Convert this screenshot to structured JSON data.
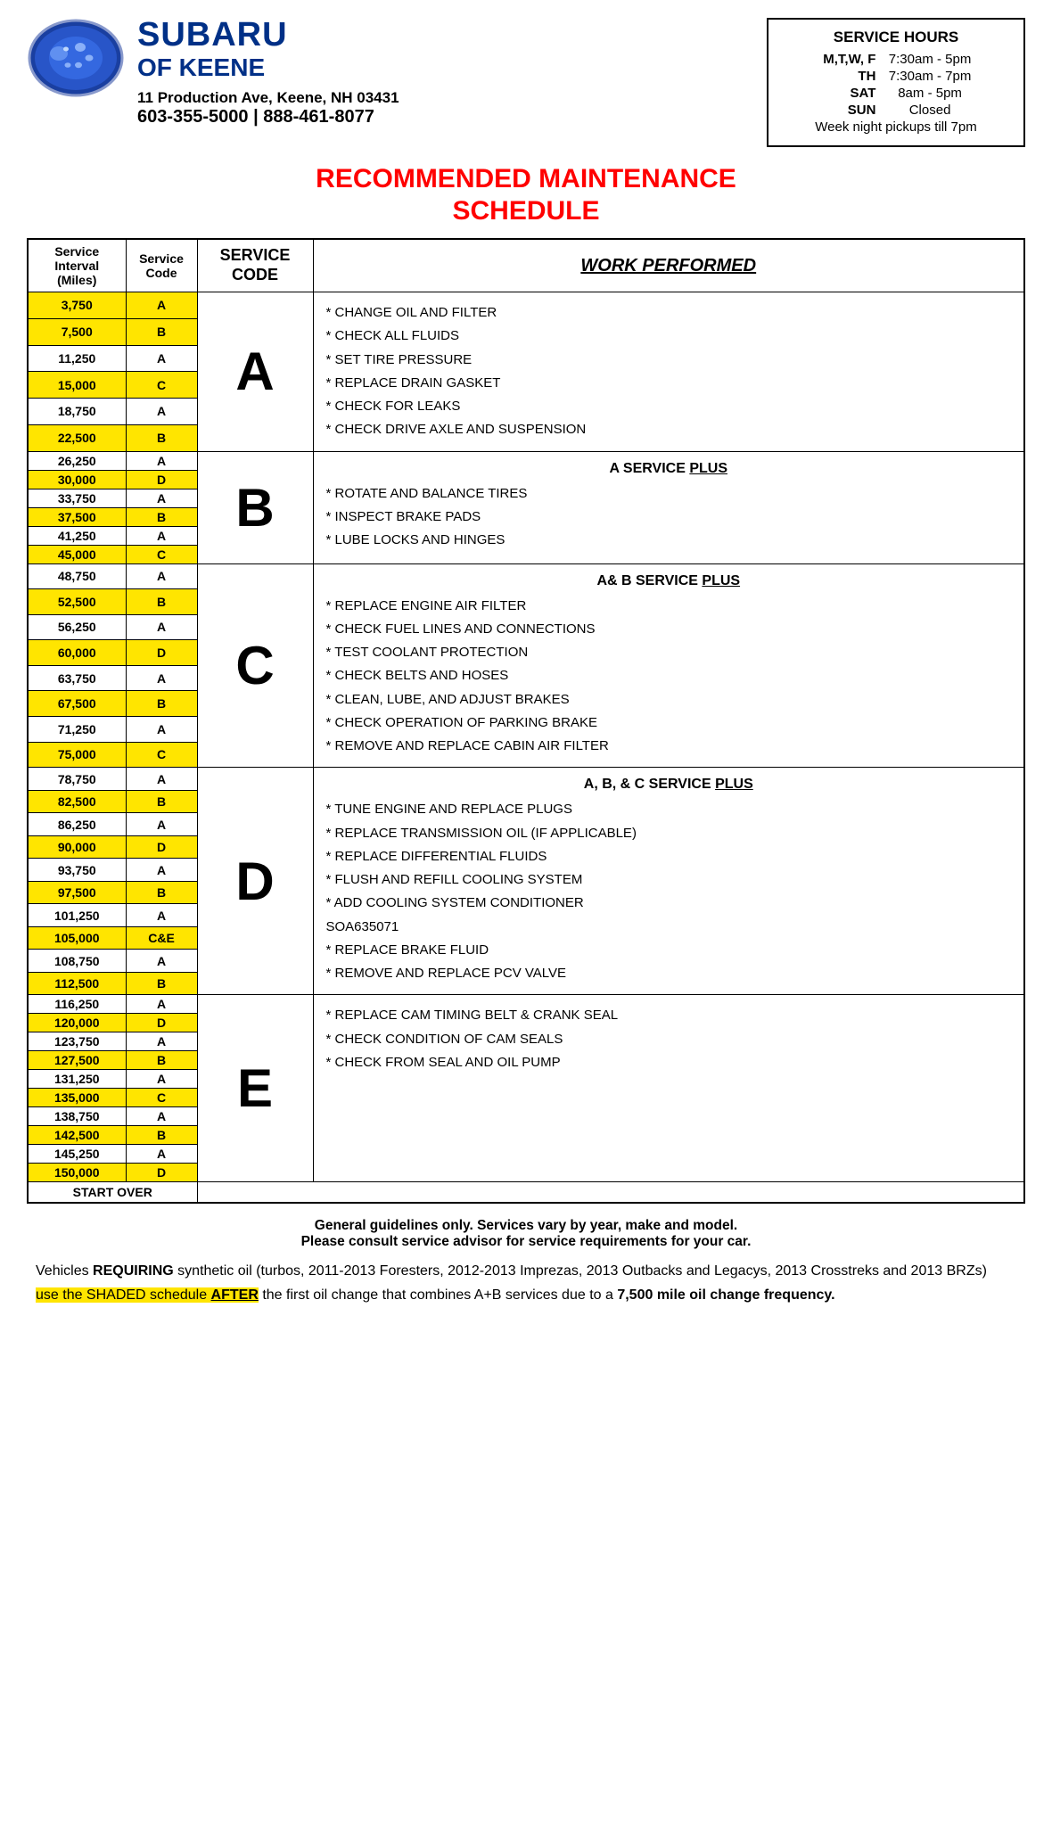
{
  "dealer": {
    "name": "SUBARU",
    "sub": "OF KEENE",
    "address": "11 Production Ave, Keene, NH  03431",
    "phone": "603-355-5000 | 888-461-8077"
  },
  "hours": {
    "title": "SERVICE HOURS",
    "rows": [
      {
        "days": "M,T,W, F",
        "time": "7:30am - 5pm"
      },
      {
        "days": "TH",
        "time": "7:30am - 7pm"
      },
      {
        "days": "SAT",
        "time": "8am - 5pm"
      },
      {
        "days": "SUN",
        "time": "Closed"
      },
      {
        "days": "",
        "time": "Week night pickups till 7pm"
      }
    ]
  },
  "main_title": "RECOMMENDED MAINTENANCE SCHEDULE",
  "table": {
    "header": {
      "interval_line1": "Service Interval",
      "interval_line2": "(Miles)",
      "code_header": "Service Code",
      "service_code_label": "SERVICE CODE",
      "work_performed_label": "WORK PERFORMED"
    },
    "intervals": [
      {
        "miles": "3,750",
        "code": "A",
        "yellow": true
      },
      {
        "miles": "7,500",
        "code": "B",
        "yellow": true
      },
      {
        "miles": "11,250",
        "code": "A",
        "yellow": false
      },
      {
        "miles": "15,000",
        "code": "C",
        "yellow": true
      },
      {
        "miles": "18,750",
        "code": "A",
        "yellow": false
      },
      {
        "miles": "22,500",
        "code": "B",
        "yellow": true
      },
      {
        "miles": "26,250",
        "code": "A",
        "yellow": false
      },
      {
        "miles": "30,000",
        "code": "D",
        "yellow": true
      },
      {
        "miles": "33,750",
        "code": "A",
        "yellow": false
      },
      {
        "miles": "37,500",
        "code": "B",
        "yellow": true
      },
      {
        "miles": "41,250",
        "code": "A",
        "yellow": false
      },
      {
        "miles": "45,000",
        "code": "C",
        "yellow": true
      },
      {
        "miles": "48,750",
        "code": "A",
        "yellow": false
      },
      {
        "miles": "52,500",
        "code": "B",
        "yellow": true
      },
      {
        "miles": "56,250",
        "code": "A",
        "yellow": false
      },
      {
        "miles": "60,000",
        "code": "D",
        "yellow": true
      },
      {
        "miles": "63,750",
        "code": "A",
        "yellow": false
      },
      {
        "miles": "67,500",
        "code": "B",
        "yellow": true
      },
      {
        "miles": "71,250",
        "code": "A",
        "yellow": false
      },
      {
        "miles": "75,000",
        "code": "C",
        "yellow": true
      },
      {
        "miles": "78,750",
        "code": "A",
        "yellow": false
      },
      {
        "miles": "82,500",
        "code": "B",
        "yellow": true
      },
      {
        "miles": "86,250",
        "code": "A",
        "yellow": false
      },
      {
        "miles": "90,000",
        "code": "D",
        "yellow": true
      },
      {
        "miles": "93,750",
        "code": "A",
        "yellow": false
      },
      {
        "miles": "97,500",
        "code": "B",
        "yellow": true
      },
      {
        "miles": "101,250",
        "code": "A",
        "yellow": false
      },
      {
        "miles": "105,000",
        "code": "C&E",
        "yellow": true
      },
      {
        "miles": "108,750",
        "code": "A",
        "yellow": false
      },
      {
        "miles": "112,500",
        "code": "B",
        "yellow": true
      },
      {
        "miles": "116,250",
        "code": "A",
        "yellow": false
      },
      {
        "miles": "120,000",
        "code": "D",
        "yellow": true
      },
      {
        "miles": "123,750",
        "code": "A",
        "yellow": false
      },
      {
        "miles": "127,500",
        "code": "B",
        "yellow": true
      },
      {
        "miles": "131,250",
        "code": "A",
        "yellow": false
      },
      {
        "miles": "135,000",
        "code": "C",
        "yellow": true
      },
      {
        "miles": "138,750",
        "code": "A",
        "yellow": false
      },
      {
        "miles": "142,500",
        "code": "B",
        "yellow": true
      },
      {
        "miles": "145,250",
        "code": "A",
        "yellow": false
      },
      {
        "miles": "150,000",
        "code": "D",
        "yellow": true
      }
    ],
    "services": [
      {
        "code": "A",
        "items": [
          "* CHANGE OIL AND FILTER",
          "* CHECK ALL FLUIDS",
          "* SET TIRE PRESSURE",
          "* REPLACE DRAIN GASKET",
          "* CHECK FOR LEAKS",
          "* CHECK DRIVE AXLE AND SUSPENSION"
        ]
      },
      {
        "code": "B",
        "header": "A SERVICE PLUS",
        "items": [
          "* ROTATE AND BALANCE TIRES",
          "* INSPECT BRAKE PADS",
          "* LUBE LOCKS AND HINGES"
        ]
      },
      {
        "code": "C",
        "header": "A& B SERVICE PLUS",
        "items": [
          "* REPLACE ENGINE AIR FILTER",
          "* CHECK FUEL LINES AND CONNECTIONS",
          "* TEST COOLANT PROTECTION",
          "* CHECK BELTS AND HOSES",
          "* CLEAN, LUBE, AND ADJUST BRAKES",
          "* CHECK OPERATION OF PARKING BRAKE",
          "* REMOVE AND REPLACE CABIN AIR FILTER"
        ]
      },
      {
        "code": "D",
        "header": "A, B, & C SERVICE PLUS",
        "items": [
          "* TUNE ENGINE AND REPLACE PLUGS",
          "* REPLACE TRANSMISSION OIL (IF APPLICABLE)",
          "* REPLACE DIFFERENTIAL FLUIDS",
          "* FLUSH AND REFILL COOLING SYSTEM",
          "* ADD COOLING SYSTEM CONDITIONER\n   SOA635071",
          "* REPLACE BRAKE FLUID",
          "* REMOVE AND REPLACE PCV VALVE"
        ]
      },
      {
        "code": "E",
        "items": [
          "* REPLACE CAM TIMING BELT & CRANK SEAL",
          "* CHECK CONDITION OF CAM SEALS",
          "* CHECK FROM SEAL AND OIL PUMP"
        ]
      }
    ]
  },
  "footer": {
    "note": "General guidelines only. Services vary by year, make and model.\nPlease consult service advisor for service requirements for your car.",
    "body_parts": [
      {
        "text": "Vehicles ",
        "bold": false,
        "yellow": false
      },
      {
        "text": "REQUIRING",
        "bold": true,
        "yellow": false
      },
      {
        "text": " synthetic oil (turbos, 2011-2013 Foresters, 2012-2013 Imprezas, 2013 Outbacks and Legacys, 2013 Crosstreks and 2013 BRZs)\n",
        "bold": false,
        "yellow": false
      },
      {
        "text": "use the SHADED schedule ",
        "bold": false,
        "yellow": true
      },
      {
        "text": "AFTER",
        "bold": true,
        "yellow": true,
        "underline": true
      },
      {
        "text": " the first oil change that combines A+B services due to a ",
        "bold": false,
        "yellow": false
      },
      {
        "text": "7,500 mile oil change frequency.",
        "bold": true,
        "yellow": false
      }
    ]
  }
}
